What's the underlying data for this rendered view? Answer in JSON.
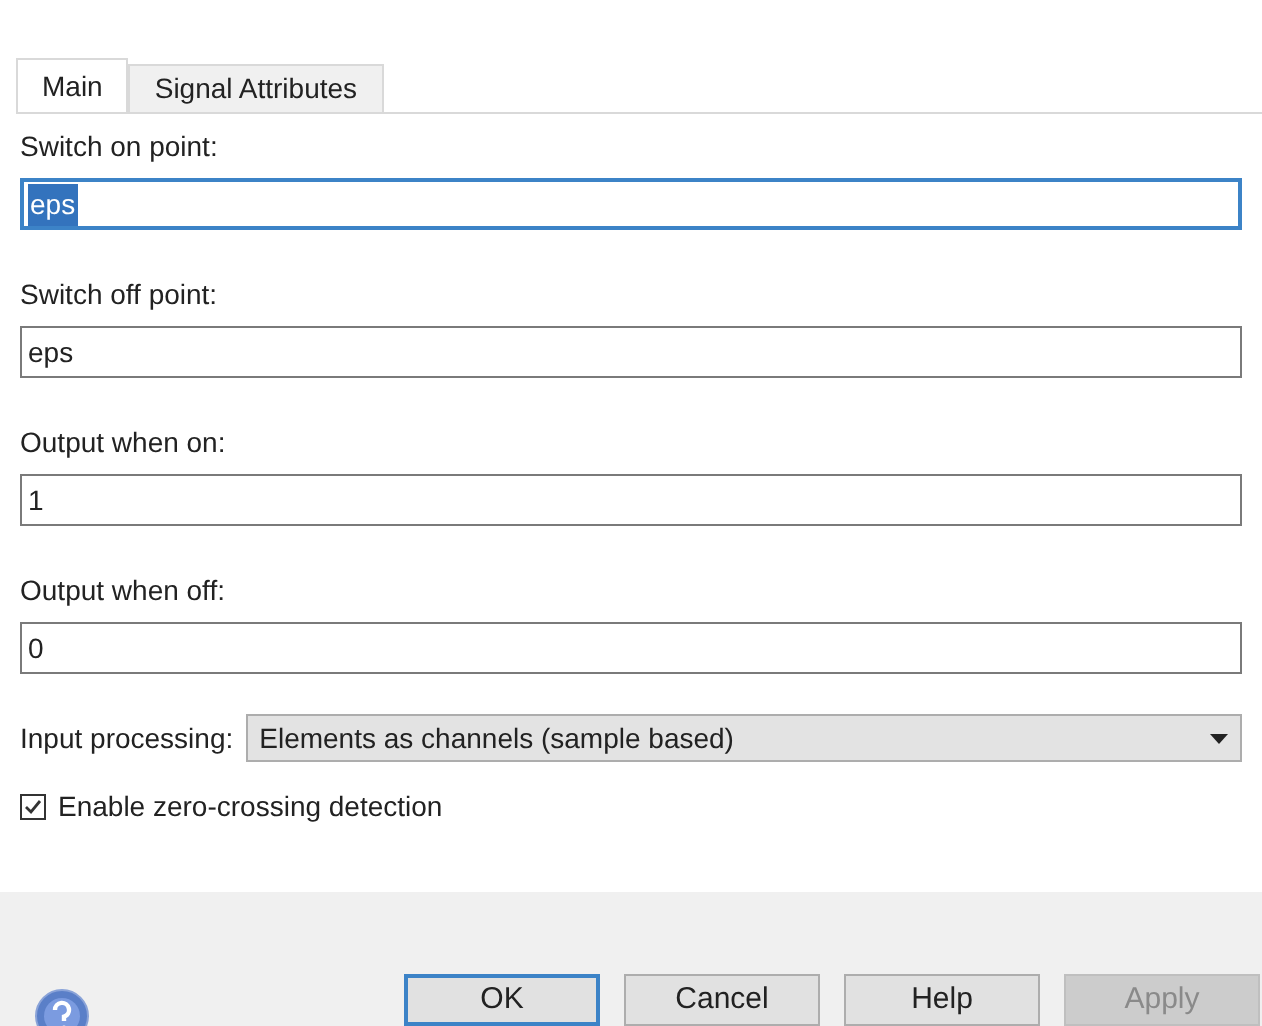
{
  "tabs": [
    {
      "label": "Main",
      "selected": true
    },
    {
      "label": "Signal Attributes",
      "selected": false
    }
  ],
  "fields": [
    {
      "label": "Switch on point:",
      "value": "eps",
      "text_selected": true
    },
    {
      "label": "Switch off point:",
      "value": "eps",
      "text_selected": false
    },
    {
      "label": "Output when on:",
      "value": "1",
      "text_selected": false
    },
    {
      "label": "Output when off:",
      "value": "0",
      "text_selected": false
    }
  ],
  "input_processing": {
    "label": "Input processing:",
    "value": "Elements as channels (sample based)"
  },
  "checkbox": {
    "label": "Enable zero-crossing detection",
    "checked": true
  },
  "buttons": [
    {
      "label": "OK",
      "default": true,
      "disabled": false
    },
    {
      "label": "Cancel",
      "default": false,
      "disabled": false
    },
    {
      "label": "Help",
      "default": false,
      "disabled": false
    },
    {
      "label": "Apply",
      "default": false,
      "disabled": true
    }
  ]
}
